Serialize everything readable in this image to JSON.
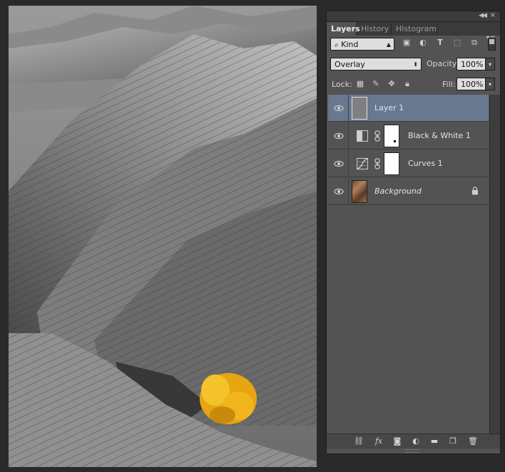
{
  "panel": {
    "collapse_icon": "double-left-arrow-icon",
    "close_icon": "close-icon",
    "tabs": [
      {
        "label": "Layers",
        "active": true
      },
      {
        "label": "History",
        "active": false
      },
      {
        "label": "Histogram",
        "active": false
      }
    ],
    "menu_icon": "panel-menu-icon"
  },
  "filter": {
    "kind_label": "Kind",
    "icons": [
      "pixel-filter-icon",
      "adjustment-filter-icon",
      "type-filter-icon",
      "shape-filter-icon",
      "smart-object-filter-icon"
    ]
  },
  "blend": {
    "mode": "Overlay",
    "opacity_label": "Opacity:",
    "opacity_value": "100%"
  },
  "lock": {
    "label": "Lock:",
    "icons": [
      "lock-transparent-icon",
      "lock-image-icon",
      "lock-position-icon",
      "lock-all-icon"
    ],
    "fill_label": "Fill:",
    "fill_value": "100%"
  },
  "layers": [
    {
      "name": "Layer 1",
      "selected": true,
      "type": "pixel",
      "visible": true
    },
    {
      "name": "Black & White 1",
      "selected": false,
      "type": "adjustment-bw",
      "visible": true
    },
    {
      "name": "Curves 1",
      "selected": false,
      "type": "adjustment-curves",
      "visible": true
    },
    {
      "name": "Background",
      "selected": false,
      "type": "background",
      "visible": true,
      "locked": true
    }
  ],
  "bottom_icons": [
    "link-layers-icon",
    "fx-icon",
    "add-mask-icon",
    "new-adjustment-icon",
    "new-group-icon",
    "new-layer-icon",
    "delete-layer-icon"
  ],
  "bottom_fx_label": "fx",
  "colors": {
    "selected_layer": "#67788f",
    "panel_bg": "#535353",
    "highlight_tree": "#f2b31a"
  }
}
